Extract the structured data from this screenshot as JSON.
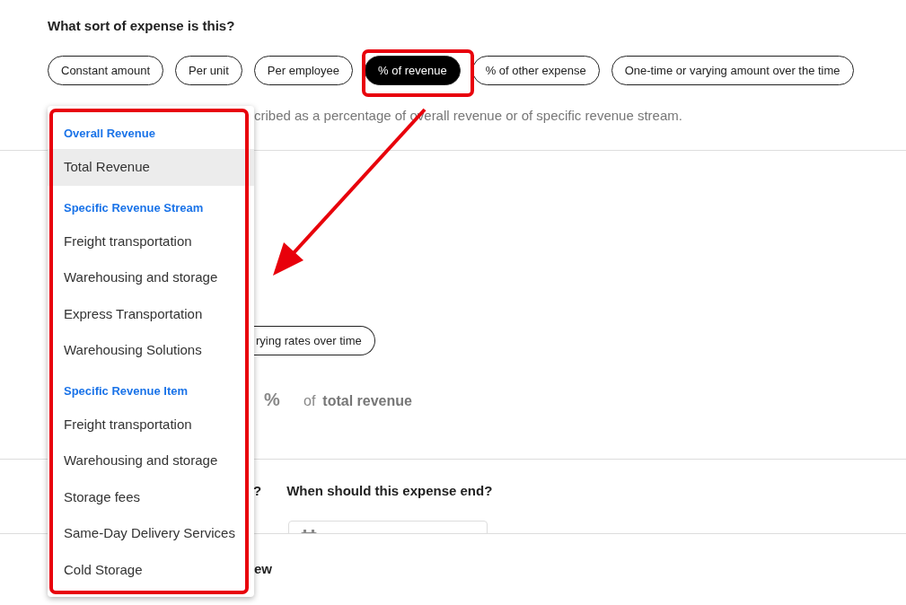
{
  "question": "What sort of expense is this?",
  "expense_types": [
    {
      "label": "Constant amount",
      "selected": false
    },
    {
      "label": "Per unit",
      "selected": false
    },
    {
      "label": "Per employee",
      "selected": false
    },
    {
      "label": "% of revenue",
      "selected": true
    },
    {
      "label": "% of other expense",
      "selected": false
    },
    {
      "label": "One-time or varying amount over the time",
      "selected": false
    }
  ],
  "description": "cribed as a percentage of overall revenue or of specific revenue stream.",
  "rate_option": {
    "label": "rying rates over time",
    "selected": false
  },
  "percent_row": {
    "symbol": "%",
    "of": "of",
    "target": "total revenue"
  },
  "start_question": "?",
  "end_question": {
    "label": "When should this expense end?"
  },
  "footer_text": "ew",
  "dropdown": {
    "groups": [
      {
        "header": "Overall Revenue",
        "items": [
          {
            "label": "Total Revenue",
            "highlighted": true
          }
        ]
      },
      {
        "header": "Specific Revenue Stream",
        "items": [
          {
            "label": "Freight transportation",
            "highlighted": false
          },
          {
            "label": "Warehousing and storage",
            "highlighted": false
          },
          {
            "label": "Express Transportation",
            "highlighted": false
          },
          {
            "label": "Warehousing Solutions",
            "highlighted": false
          }
        ]
      },
      {
        "header": "Specific Revenue Item",
        "items": [
          {
            "label": "Freight transportation",
            "highlighted": false
          },
          {
            "label": "Warehousing and storage",
            "highlighted": false
          },
          {
            "label": "Storage fees",
            "highlighted": false
          },
          {
            "label": "Same-Day Delivery Services",
            "highlighted": false
          },
          {
            "label": "Cold Storage",
            "highlighted": false
          }
        ]
      }
    ]
  }
}
